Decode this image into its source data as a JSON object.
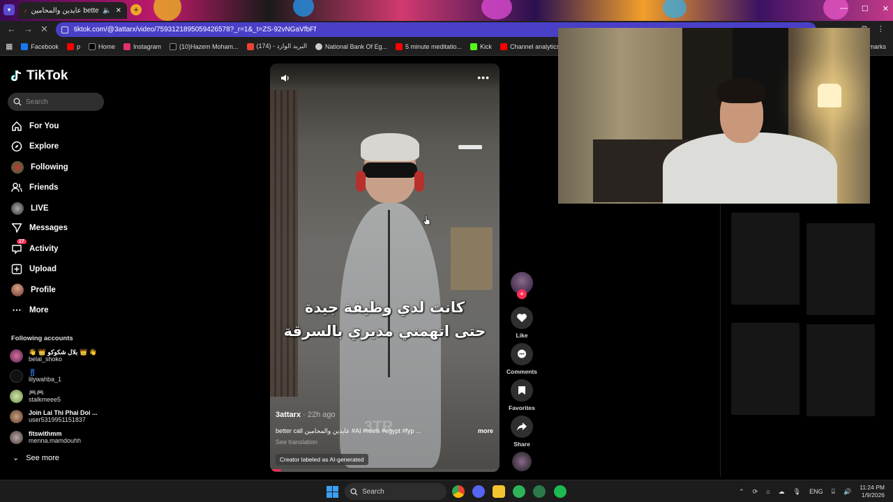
{
  "browser": {
    "tab_title": "عايدين والمحامين better call",
    "url": "tiktok.com/@3attarx/video/7593121895059426578?_r=1&_t=ZS-92vNGaVfbFf",
    "bookmarks": [
      {
        "label": "Facebook",
        "color": "#1877f2"
      },
      {
        "label": "p",
        "color": "#ff0000"
      },
      {
        "label": "Home",
        "color": "#000000"
      },
      {
        "label": "Instagram",
        "color": "#e1306c"
      },
      {
        "label": "(10)Hazem Moham...",
        "color": "#111111"
      },
      {
        "label": "(174) - البريد الوارد",
        "color": "#ea4335"
      },
      {
        "label": "National Bank Of Eg...",
        "color": "#cccccc"
      },
      {
        "label": "5 minute meditatio...",
        "color": "#ff0000"
      },
      {
        "label": "Kick",
        "color": "#53fc18"
      },
      {
        "label": "Channel analytics -...",
        "color": "#ff0000"
      }
    ],
    "bookmarks_end": "kmarks"
  },
  "tiktok": {
    "logo": "TikTok",
    "search_placeholder": "Search",
    "nav": {
      "for_you": "For You",
      "explore": "Explore",
      "following": "Following",
      "friends": "Friends",
      "live": "LIVE",
      "messages": "Messages",
      "activity": "Activity",
      "activity_badge": "27",
      "upload": "Upload",
      "profile": "Profile",
      "more": "More"
    },
    "following_title": "Following accounts",
    "accounts": [
      {
        "name": "👋 👑 بلال شكوكو 👑 👋",
        "handle": "belal_shoko"
      },
      {
        "name": "👖",
        "handle": "lilywahba_1"
      },
      {
        "name": "🎮🎮",
        "handle": "stalkmeee5"
      },
      {
        "name": "Join Lai Thi Phai Doi ...",
        "handle": "user5319951151837"
      },
      {
        "name": "fitswithmm",
        "handle": "menna.mamdouhh"
      }
    ],
    "see_more": "See more"
  },
  "video": {
    "caption_line1": "كانت لدي وظيفة جيدة",
    "caption_line2": "حتى اتهمني مديري بالسرقة",
    "author": "3attarx",
    "time": " · 22h ago",
    "description": "better call عايدين والمحامين #AI #reels #egypt #fyp ...",
    "more": "more",
    "see_translation": "See translation",
    "ai_label": "Creator labeled as AI-generated",
    "watermark": "3TR",
    "progress": 0.04
  },
  "actions": {
    "like": "Like",
    "comments": "Comments",
    "favorites": "Favorites",
    "share": "Share"
  },
  "taskbar": {
    "search": "Search",
    "lang": "ENG",
    "time": "11:24 PM",
    "date": "1/9/2026"
  },
  "colors": {
    "accent": "#fe2c55",
    "url_bar": "#4a3fc7"
  }
}
